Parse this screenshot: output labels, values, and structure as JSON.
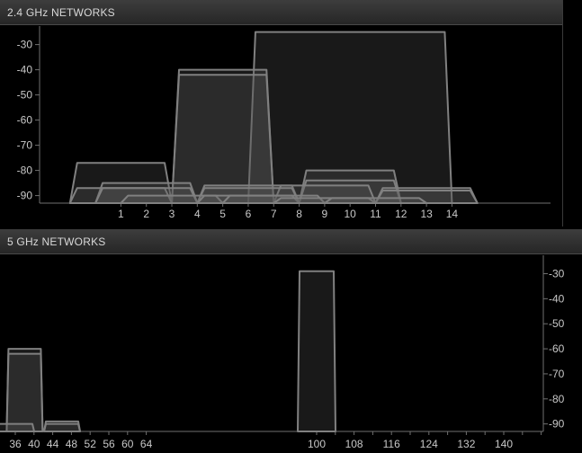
{
  "chart_data": [
    {
      "type": "area",
      "title": "2.4 GHz NETWORKS",
      "y_ticks": [
        -30,
        -40,
        -50,
        -60,
        -70,
        -80,
        -90
      ],
      "ylim": [
        -93,
        -23
      ],
      "x_ticks": [
        1,
        2,
        3,
        4,
        5,
        6,
        7,
        8,
        9,
        10,
        11,
        12,
        13,
        14
      ],
      "y_axis_side": "left",
      "networks": [
        {
          "channel": 10,
          "width_mhz": 40,
          "signal": -25
        },
        {
          "channel": 5,
          "width_mhz": 20,
          "signal": -40
        },
        {
          "channel": 5,
          "width_mhz": 20,
          "signal": -42
        },
        {
          "channel": 1,
          "width_mhz": 20,
          "signal": -77
        },
        {
          "channel": 10,
          "width_mhz": 20,
          "signal": -80
        },
        {
          "channel": 10,
          "width_mhz": 20,
          "signal": -84
        },
        {
          "channel": 2,
          "width_mhz": 20,
          "signal": -85
        },
        {
          "channel": 1,
          "width_mhz": 20,
          "signal": -87
        },
        {
          "channel": 2,
          "width_mhz": 20,
          "signal": -87
        },
        {
          "channel": 6,
          "width_mhz": 20,
          "signal": -86
        },
        {
          "channel": 9,
          "width_mhz": 20,
          "signal": -86
        },
        {
          "channel": 6,
          "width_mhz": 20,
          "signal": -87
        },
        {
          "channel": 13,
          "width_mhz": 20,
          "signal": -87
        },
        {
          "channel": 13,
          "width_mhz": 20,
          "signal": -88
        },
        {
          "channel": 3,
          "width_mhz": 20,
          "signal": -90
        },
        {
          "channel": 6,
          "width_mhz": 20,
          "signal": -90
        },
        {
          "channel": 7,
          "width_mhz": 20,
          "signal": -90
        },
        {
          "channel": 9,
          "width_mhz": 20,
          "signal": -91
        },
        {
          "channel": 11,
          "width_mhz": 20,
          "signal": -91
        }
      ]
    },
    {
      "type": "area",
      "title": "5 GHz NETWORKS",
      "y_ticks": [
        -30,
        -40,
        -50,
        -60,
        -70,
        -80,
        -90
      ],
      "ylim": [
        -93,
        -23
      ],
      "x_ticks": [
        36,
        40,
        44,
        48,
        52,
        56,
        60,
        64,
        100,
        108,
        116,
        124,
        132,
        140
      ],
      "y_axis_side": "right",
      "networks": [
        {
          "channel": 100,
          "width_mhz": 20,
          "signal": -29
        },
        {
          "channel": 38,
          "width_mhz": 40,
          "signal": -60
        },
        {
          "channel": 38,
          "width_mhz": 40,
          "signal": -62
        },
        {
          "channel": 46,
          "width_mhz": 40,
          "signal": -89
        },
        {
          "channel": 36,
          "width_mhz": 20,
          "signal": -90
        },
        {
          "channel": 46,
          "width_mhz": 40,
          "signal": -90
        }
      ]
    }
  ]
}
